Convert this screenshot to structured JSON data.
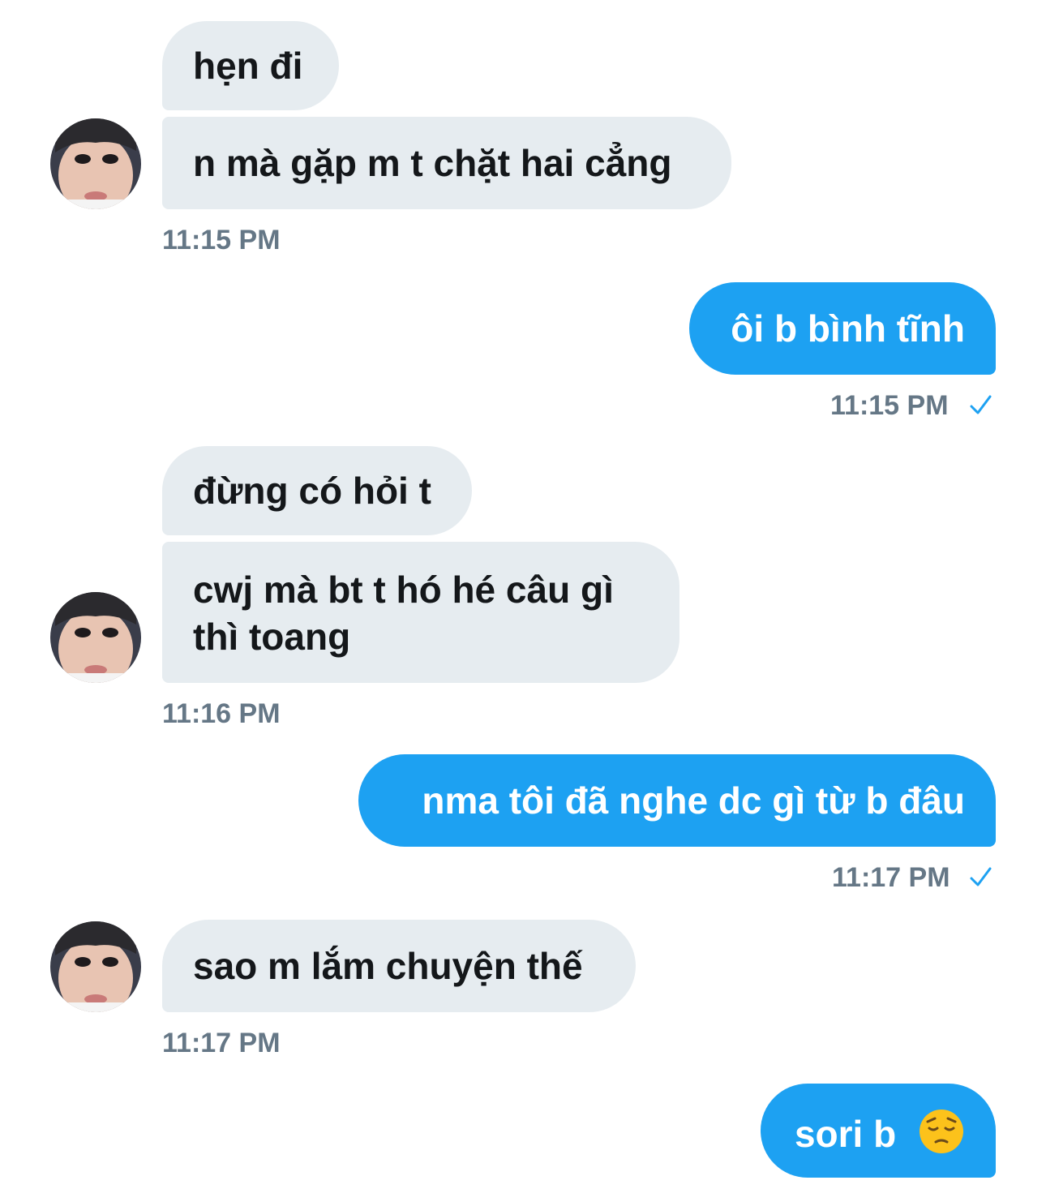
{
  "conversation": {
    "messages": [
      {
        "direction": "received",
        "text": "hẹn đi"
      },
      {
        "direction": "received",
        "text": "n mà gặp m t chặt hai cẳng"
      },
      {
        "direction": "received_time",
        "text": "11:15 PM"
      },
      {
        "direction": "sent",
        "text": "ôi b bình tĩnh"
      },
      {
        "direction": "sent_time",
        "text": "11:15 PM",
        "status": "sent-check"
      },
      {
        "direction": "received",
        "text": "đừng có hỏi t"
      },
      {
        "direction": "received",
        "line1": "cwj mà bt t hó hé câu gì",
        "line2": "thì toang"
      },
      {
        "direction": "received_time",
        "text": "11:16 PM"
      },
      {
        "direction": "sent",
        "text": "nma tôi đã nghe dc gì từ b đâu"
      },
      {
        "direction": "sent_time",
        "text": "11:17 PM",
        "status": "sent-check"
      },
      {
        "direction": "received",
        "text": "sao m lắm chuyện thế"
      },
      {
        "direction": "received_time",
        "text": "11:17 PM"
      },
      {
        "direction": "sent",
        "text": "sori b",
        "emoji": "pensive-face"
      }
    ]
  },
  "colors": {
    "sent_bubble": "#1da1f2",
    "received_bubble": "#e6ecf0",
    "timestamp": "#657786"
  }
}
